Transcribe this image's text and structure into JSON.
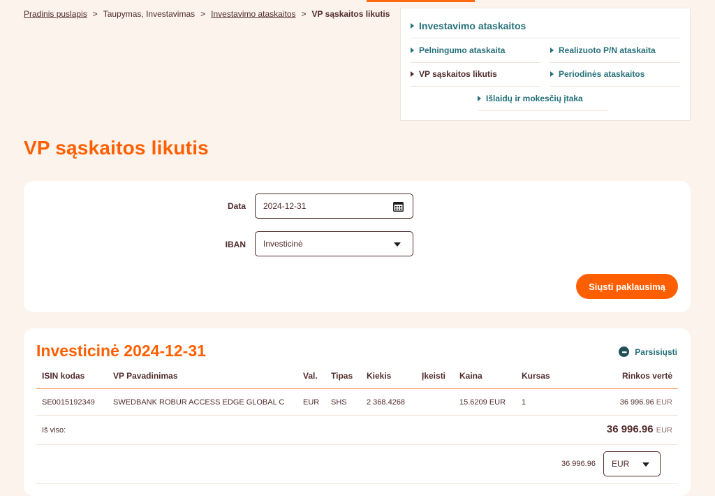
{
  "breadcrumb": {
    "home": "Pradinis puslapis",
    "section": "Taupymas, Investavimas",
    "reports": "Investavimo ataskaitos",
    "current": "VP sąskaitos likutis",
    "separator": ">"
  },
  "nav_panel": {
    "heading": "Investavimo ataskaitos",
    "items": [
      {
        "label": "Pelningumo ataskaita"
      },
      {
        "label": "Realizuoto P/N ataskaita"
      },
      {
        "label": "VP sąskaitos likutis"
      },
      {
        "label": "Periodinės ataskaitos"
      },
      {
        "label": "Išlaidų ir mokesčių įtaka"
      }
    ]
  },
  "page_title": "VP sąskaitos likutis",
  "form": {
    "date_label": "Data",
    "date_value": "2024-12-31",
    "iban_label": "IBAN",
    "iban_value": "Investicinė",
    "submit_label": "Siųsti paklausimą"
  },
  "results": {
    "title": "Investicinė 2024-12-31",
    "download_label": "Parsisiųsti",
    "download_icon": "more-dots-icon",
    "columns": [
      "ISIN kodas",
      "VP Pavadinimas",
      "Val.",
      "Tipas",
      "Kiekis",
      "Įkeisti",
      "Kaina",
      "Kursas",
      "Rinkos vertė"
    ],
    "rows": [
      {
        "isin": "SE0015192349",
        "name": "SWEDBANK ROBUR ACCESS EDGE GLOBAL C",
        "currency": "EUR",
        "type": "SHS",
        "quantity": "2 368.4268",
        "pledged": "",
        "price": "15.6209 EUR",
        "rate": "1",
        "market_value": "36 996.96",
        "market_value_unit": "EUR"
      }
    ],
    "total_label": "Iš viso:",
    "total_value": "36 996.96",
    "total_unit": "EUR",
    "converted_value": "36 996.96",
    "currency_select": "EUR"
  },
  "colors": {
    "accent": "#ff5f00",
    "link": "#25707a",
    "text": "#512b2b",
    "background": "#fbf3ec"
  }
}
